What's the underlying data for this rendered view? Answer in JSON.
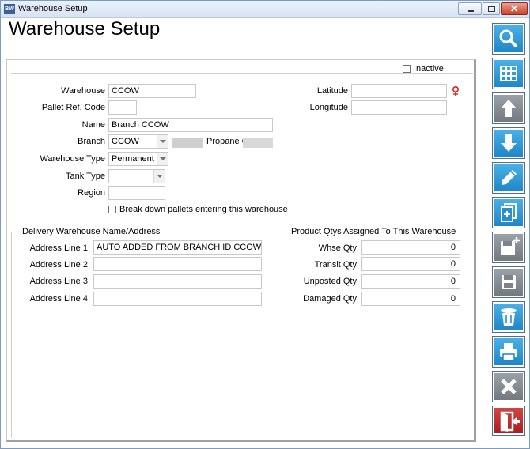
{
  "window": {
    "title": "Warehouse Setup",
    "app_icon_text": "BW",
    "min_label": "",
    "max_label": "",
    "close_label": "✕"
  },
  "page": {
    "title": "Warehouse Setup"
  },
  "inactive": {
    "label": "Inactive",
    "checked": false
  },
  "warehouse": {
    "warehouse_label": "Warehouse",
    "warehouse_value": "CCOW",
    "pallet_ref_label": "Pallet Ref. Code",
    "pallet_ref_value": "",
    "name_label": "Name",
    "name_value": "Branch CCOW",
    "branch_label": "Branch",
    "branch_value": "CCOW",
    "branch_desc": "Propane C",
    "type_label": "Warehouse Type",
    "type_value": "Permanent",
    "tank_label": "Tank Type",
    "tank_value": "",
    "region_label": "Region",
    "region_value": "",
    "latitude_label": "Latitude",
    "latitude_value": "",
    "longitude_label": "Longitude",
    "longitude_value": "",
    "breakdown_label": "Break down pallets entering this warehouse",
    "breakdown_checked": false
  },
  "delivery": {
    "title": "Delivery Warehouse Name/Address",
    "lines": [
      {
        "label": "Address Line 1:",
        "value": "AUTO ADDED FROM BRANCH ID CCOW"
      },
      {
        "label": "Address Line 2:",
        "value": ""
      },
      {
        "label": "Address Line 3:",
        "value": ""
      },
      {
        "label": "Address Line 4:",
        "value": ""
      }
    ]
  },
  "qtys": {
    "title": "Product Qtys Assigned To This Warehouse",
    "rows": [
      {
        "label": "Whse Qty",
        "value": "0"
      },
      {
        "label": "Transit Qty",
        "value": "0"
      },
      {
        "label": "Unposted Qty",
        "value": "0"
      },
      {
        "label": "Damaged Qty",
        "value": "0"
      }
    ]
  },
  "toolbar": [
    {
      "icon": "search-icon",
      "color": "blue"
    },
    {
      "icon": "grid-icon",
      "color": "blue"
    },
    {
      "icon": "arrow-up-icon",
      "color": "gray"
    },
    {
      "icon": "arrow-down-icon",
      "color": "blue"
    },
    {
      "icon": "pencil-icon",
      "color": "blue"
    },
    {
      "icon": "copy-document-icon",
      "color": "blue"
    },
    {
      "icon": "new-record-icon",
      "color": "gray"
    },
    {
      "icon": "save-icon",
      "color": "gray"
    },
    {
      "icon": "trash-icon",
      "color": "blue"
    },
    {
      "icon": "printer-icon",
      "color": "blue"
    },
    {
      "icon": "close-x-icon",
      "color": "gray"
    },
    {
      "icon": "exit-door-icon",
      "color": "red"
    }
  ]
}
